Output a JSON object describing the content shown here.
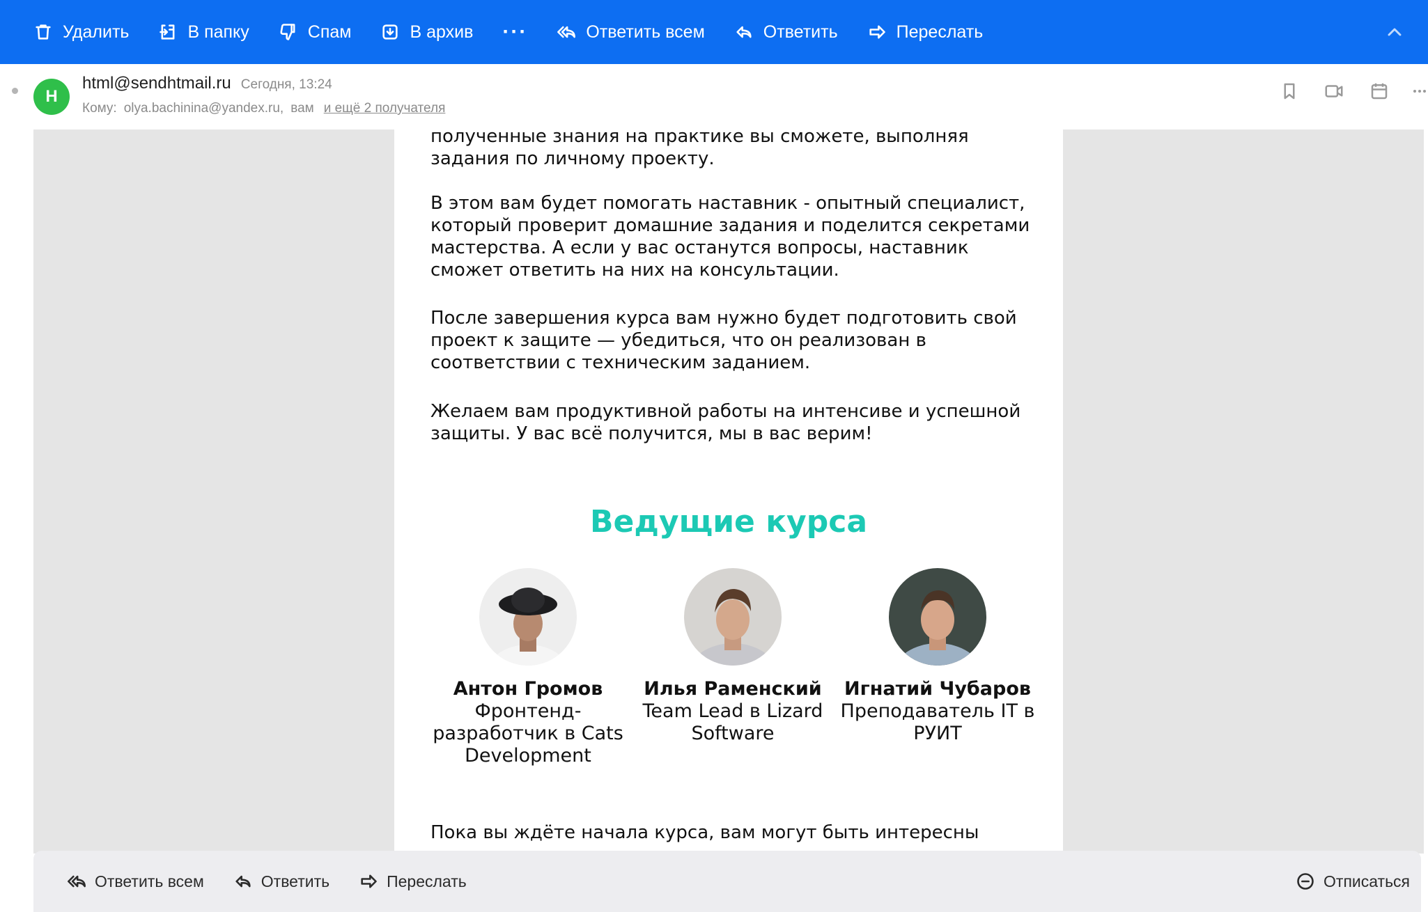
{
  "toolbar": {
    "delete": "Удалить",
    "to_folder": "В папку",
    "spam": "Спам",
    "archive": "В архив",
    "more": "···",
    "reply_all": "Ответить всем",
    "reply": "Ответить",
    "forward": "Переслать"
  },
  "message": {
    "sender_initial": "H",
    "sender": "html@sendhtmail.ru",
    "date": "Сегодня, 13:24",
    "to_label": "Кому:",
    "recipient": "olya.bachinina@yandex.ru,",
    "recipient_self": "вам",
    "more_recipients": "и ещё 2 получателя"
  },
  "body": {
    "paragraphs": [
      "полученные знания на практике вы сможете, выполняя задания по личному проекту.",
      "В этом вам будет помогать наставник - опытный специалист, который проверит домашние задания и поделится секретами мастерства. А если у вас останутся вопросы, наставник сможет ответить на них на консультации.",
      "После завершения курса вам нужно будет подготовить свой проект к защите — убедиться, что он реализован в соответствии с техническим заданием.",
      "Желаем вам продуктивной работы на интенсиве и успешной защиты. У вас всё получится, мы в вас верим!"
    ],
    "section_title": "Ведущие курса",
    "instructors": [
      {
        "name": "Антон Громов",
        "role": "Фронтенд-разработчик в Cats Development"
      },
      {
        "name": "Илья Раменский",
        "role": "Team Lead в Lizard Software"
      },
      {
        "name": "Игнатий Чубаров",
        "role": "Преподаватель IT в РУИТ"
      }
    ],
    "footer_text": "Пока вы ждёте начала курса, вам могут быть интересны"
  },
  "bottom_bar": {
    "reply_all": "Ответить всем",
    "reply": "Ответить",
    "forward": "Переслать",
    "unsubscribe": "Отписаться"
  },
  "colors": {
    "toolbar": "#0d6ef2",
    "avatar": "#2fbf4a",
    "accent": "#1cc9b4",
    "side_panel": "#e5e5e5"
  },
  "icons": {
    "delete": "trash-icon",
    "folder": "folder-move-icon",
    "spam": "thumbs-down-icon",
    "archive": "archive-icon",
    "reply_all": "reply-all-icon",
    "reply": "reply-icon",
    "forward": "forward-icon",
    "collapse": "chevron-up-icon",
    "bookmark": "bookmark-icon",
    "video": "video-call-icon",
    "calendar": "calendar-icon",
    "unsubscribe": "minus-circle-icon"
  }
}
